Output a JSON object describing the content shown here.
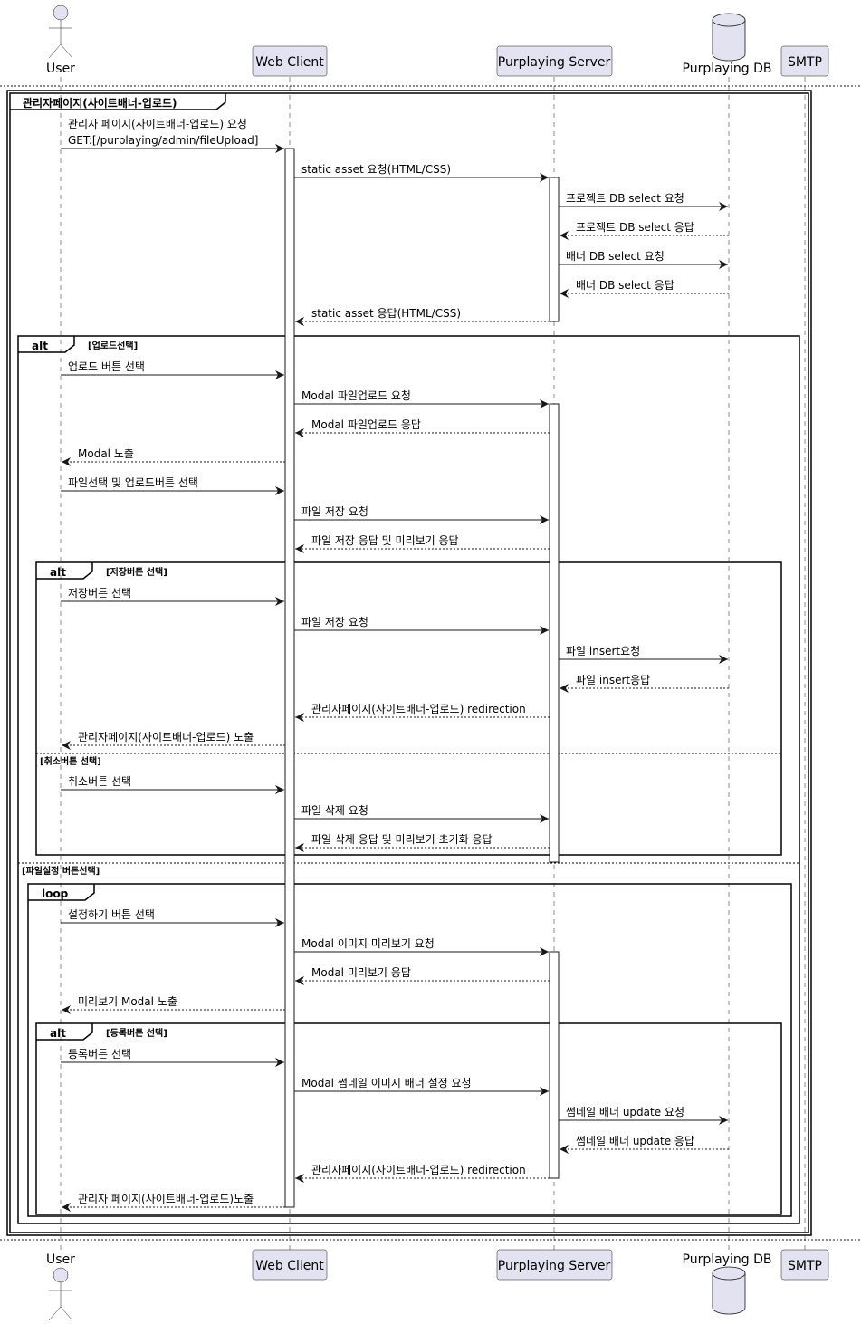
{
  "participants": [
    {
      "id": "user",
      "label": "User",
      "kind": "actor"
    },
    {
      "id": "web",
      "label": "Web Client",
      "kind": "box"
    },
    {
      "id": "server",
      "label": "Purplaying Server",
      "kind": "box"
    },
    {
      "id": "db",
      "label": "Purplaying DB",
      "kind": "database"
    },
    {
      "id": "smtp",
      "label": "SMTP",
      "kind": "box"
    }
  ],
  "frames": [
    {
      "keyword": "",
      "title": "관리자페이지(사이트배너-업로드)"
    },
    {
      "keyword": "alt",
      "guard": "[업로드선택]",
      "else_guard": "[파일설정 버튼선택]"
    },
    {
      "keyword": "alt",
      "guard": "[저장버튼 선택]",
      "else_guard": "[취소버튼 선택]"
    },
    {
      "keyword": "loop",
      "guard": ""
    },
    {
      "keyword": "alt",
      "guard": "[등록버튼 선택]"
    }
  ],
  "messages": [
    {
      "from": "user",
      "to": "web",
      "style": "solid",
      "lines": [
        "관리자 페이지(사이트배너-업로드) 요청",
        "GET:[/purplaying/admin/fileUpload]"
      ]
    },
    {
      "from": "web",
      "to": "server",
      "style": "solid",
      "lines": [
        "static asset 요청(HTML/CSS)"
      ]
    },
    {
      "from": "server",
      "to": "db",
      "style": "solid",
      "lines": [
        "프로젝트 DB select 요청"
      ]
    },
    {
      "from": "db",
      "to": "server",
      "style": "dashed",
      "lines": [
        "프로젝트 DB select 응답"
      ]
    },
    {
      "from": "server",
      "to": "db",
      "style": "solid",
      "lines": [
        "배너 DB select 요청"
      ]
    },
    {
      "from": "db",
      "to": "server",
      "style": "dashed",
      "lines": [
        "배너 DB select 응답"
      ]
    },
    {
      "from": "server",
      "to": "web",
      "style": "dashed",
      "lines": [
        "static asset 응답(HTML/CSS)"
      ]
    },
    {
      "from": "user",
      "to": "web",
      "style": "solid",
      "lines": [
        "업로드 버튼 선택"
      ]
    },
    {
      "from": "web",
      "to": "server",
      "style": "solid",
      "lines": [
        "Modal 파일업로드 요청"
      ]
    },
    {
      "from": "server",
      "to": "web",
      "style": "dashed",
      "lines": [
        "Modal 파일업로드 응답"
      ]
    },
    {
      "from": "web",
      "to": "user",
      "style": "dashed",
      "lines": [
        "Modal 노출"
      ]
    },
    {
      "from": "user",
      "to": "web",
      "style": "solid",
      "lines": [
        "파일선택 및 업로드버튼 선택"
      ]
    },
    {
      "from": "web",
      "to": "server",
      "style": "solid",
      "lines": [
        "파일 저장 요청"
      ]
    },
    {
      "from": "server",
      "to": "web",
      "style": "dashed",
      "lines": [
        "파일 저장 응답 및 미리보기 응답"
      ]
    },
    {
      "from": "user",
      "to": "web",
      "style": "solid",
      "lines": [
        "저장버튼 선택"
      ]
    },
    {
      "from": "web",
      "to": "server",
      "style": "solid",
      "lines": [
        "파일 저장 요청"
      ]
    },
    {
      "from": "server",
      "to": "db",
      "style": "solid",
      "lines": [
        "파일 insert요청"
      ]
    },
    {
      "from": "db",
      "to": "server",
      "style": "dashed",
      "lines": [
        "파일 insert응답"
      ]
    },
    {
      "from": "server",
      "to": "web",
      "style": "dashed",
      "lines": [
        "관리자페이지(사이트배너-업로드) redirection"
      ]
    },
    {
      "from": "web",
      "to": "user",
      "style": "dashed",
      "lines": [
        "관리자페이지(사이트배너-업로드) 노출"
      ]
    },
    {
      "from": "user",
      "to": "web",
      "style": "solid",
      "lines": [
        "취소버튼 선택"
      ]
    },
    {
      "from": "web",
      "to": "server",
      "style": "solid",
      "lines": [
        "파일 삭제 요청"
      ]
    },
    {
      "from": "server",
      "to": "web",
      "style": "dashed",
      "lines": [
        "파일 삭제 응답 및 미리보기 초기화 응답"
      ]
    },
    {
      "from": "user",
      "to": "web",
      "style": "solid",
      "lines": [
        "설정하기 버튼 선택"
      ]
    },
    {
      "from": "web",
      "to": "server",
      "style": "solid",
      "lines": [
        "Modal 이미지 미리보기 요청"
      ]
    },
    {
      "from": "server",
      "to": "web",
      "style": "dashed",
      "lines": [
        "Modal 미리보기 응답"
      ]
    },
    {
      "from": "web",
      "to": "user",
      "style": "dashed",
      "lines": [
        "미리보기 Modal 노출"
      ]
    },
    {
      "from": "user",
      "to": "web",
      "style": "solid",
      "lines": [
        "등록버튼 선택"
      ]
    },
    {
      "from": "web",
      "to": "server",
      "style": "solid",
      "lines": [
        "Modal 썸네일 이미지 배너 설정 요청"
      ]
    },
    {
      "from": "server",
      "to": "db",
      "style": "solid",
      "lines": [
        "썸네일 배너 update 요청"
      ]
    },
    {
      "from": "db",
      "to": "server",
      "style": "dashed",
      "lines": [
        "썸네일 배너 update 응답"
      ]
    },
    {
      "from": "server",
      "to": "web",
      "style": "dashed",
      "lines": [
        "관리자페이지(사이트배너-업로드) redirection"
      ]
    },
    {
      "from": "web",
      "to": "user",
      "style": "dashed",
      "lines": [
        "관리자 페이지(사이트배너-업로드)노출"
      ]
    }
  ]
}
